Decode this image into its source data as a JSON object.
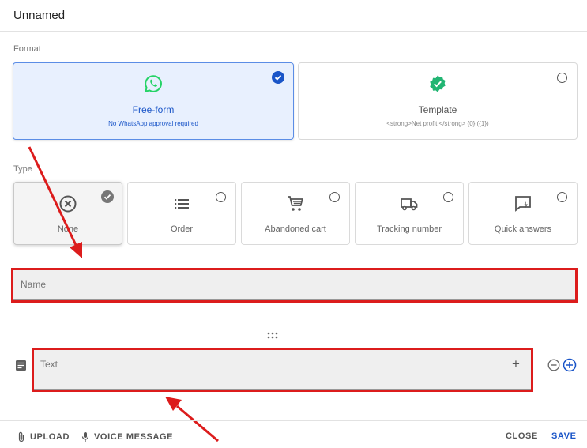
{
  "header": {
    "title": "Unnamed"
  },
  "format": {
    "label": "Format",
    "options": [
      {
        "name": "Free-form",
        "description": "No WhatsApp approval required",
        "icon": "whatsapp-icon",
        "selected": true
      },
      {
        "name": "Template",
        "description": "<strong>Net profit:</strong> {0} ({1})",
        "icon": "verified-badge-icon",
        "selected": false
      }
    ]
  },
  "type": {
    "label": "Type",
    "options": [
      {
        "name": "None",
        "icon": "cancel-circle-icon",
        "selected": true
      },
      {
        "name": "Order",
        "icon": "list-icon",
        "selected": false
      },
      {
        "name": "Abandoned cart",
        "icon": "cart-icon",
        "selected": false
      },
      {
        "name": "Tracking number",
        "icon": "truck-icon",
        "selected": false
      },
      {
        "name": "Quick answers",
        "icon": "chat-flash-icon",
        "selected": false
      }
    ]
  },
  "name_field": {
    "placeholder": "Name"
  },
  "text_field": {
    "placeholder": "Text",
    "add_symbol": "+"
  },
  "footer": {
    "upload": "UPLOAD",
    "voice": "VOICE MESSAGE",
    "close": "CLOSE",
    "save": "SAVE"
  },
  "colors": {
    "accent": "#1a55c8",
    "whatsapp": "#25d366",
    "highlight": "#dc1c1c"
  }
}
